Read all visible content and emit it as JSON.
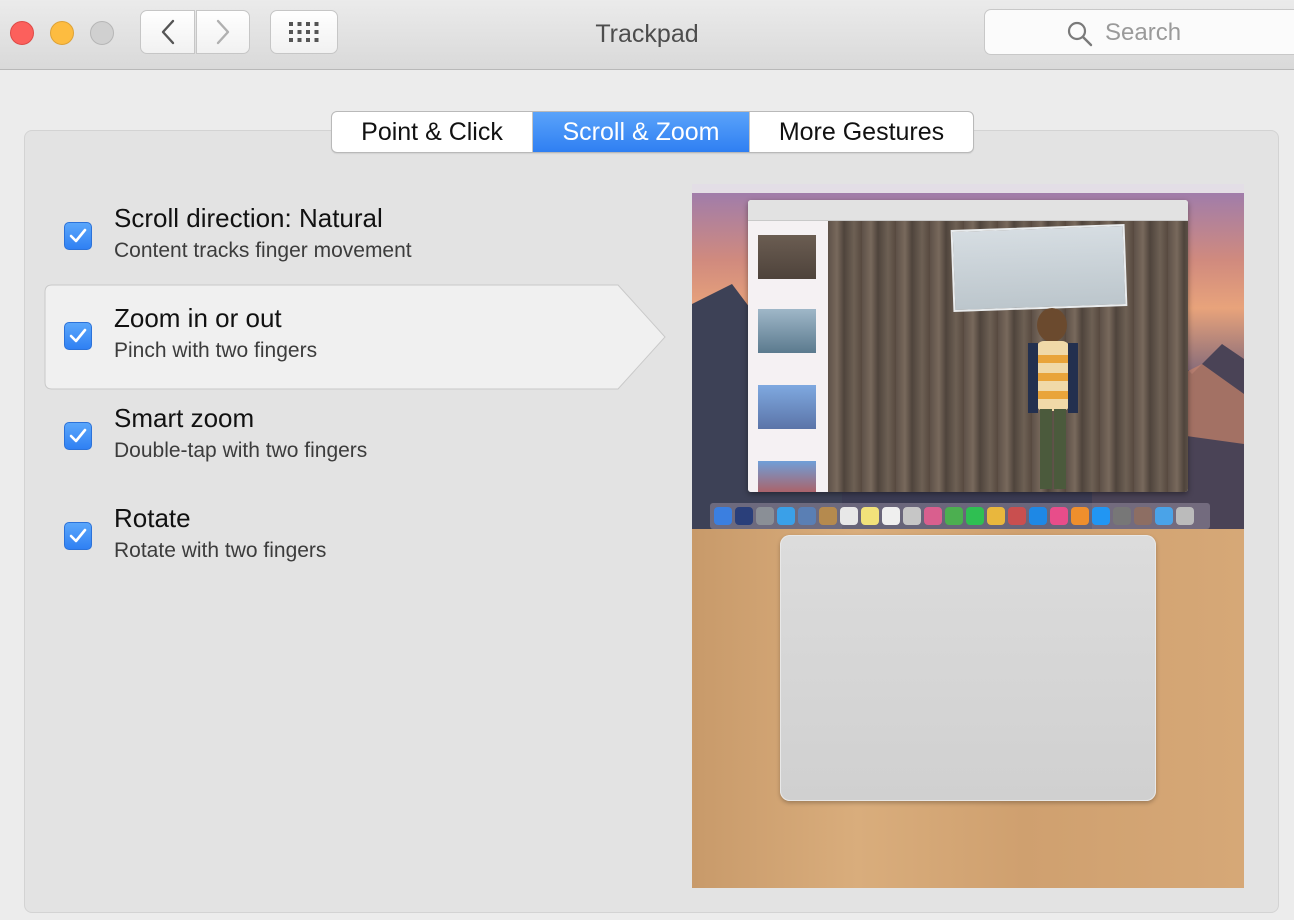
{
  "window": {
    "title": "Trackpad",
    "search_placeholder": "Search"
  },
  "toolbar": {
    "back_icon": "chevron-left-icon",
    "forward_icon": "chevron-right-icon",
    "grid_icon": "show-all-grid-icon"
  },
  "tabs": [
    {
      "label": "Point & Click",
      "selected": false
    },
    {
      "label": "Scroll & Zoom",
      "selected": true
    },
    {
      "label": "More Gestures",
      "selected": false
    }
  ],
  "options": [
    {
      "title": "Scroll direction: Natural",
      "subtitle": "Content tracks finger movement",
      "checked": true,
      "selected": false
    },
    {
      "title": "Zoom in or out",
      "subtitle": "Pinch with two fingers",
      "checked": true,
      "selected": true
    },
    {
      "title": "Smart zoom",
      "subtitle": "Double-tap with two fingers",
      "checked": true,
      "selected": false
    },
    {
      "title": "Rotate",
      "subtitle": "Rotate with two fingers",
      "checked": true,
      "selected": false
    }
  ],
  "colors": {
    "accent": "#3b8df7",
    "close": "#fc605c",
    "minimize": "#fdbc40"
  }
}
